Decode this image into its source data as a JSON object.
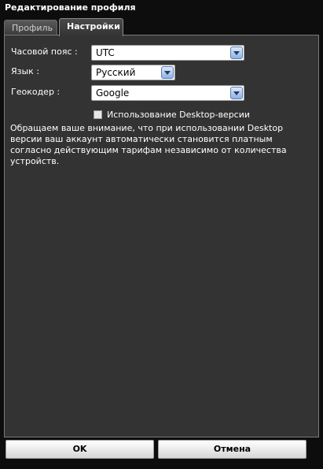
{
  "window": {
    "title": "Редактирование профиля"
  },
  "tabs": [
    {
      "label": "Профиль",
      "active": false
    },
    {
      "label": "Настройки",
      "active": true
    }
  ],
  "settings": {
    "timezone": {
      "label": "Часовой пояс :",
      "value": "UTC"
    },
    "language": {
      "label": "Язык :",
      "value": "Русский"
    },
    "geocoder": {
      "label": "Геокодер :",
      "value": "Google"
    },
    "desktop_checkbox": {
      "label": "Использование Desktop-версии",
      "checked": false
    },
    "notice": "Обращаем ваше внимание, что при использовании Desktop версии ваш аккаунт автоматически становится платным согласно действующим тарифам независимо от количества устройств."
  },
  "footer": {
    "ok_label": "OK",
    "cancel_label": "Отмена"
  },
  "colors": {
    "panel": "#333333",
    "background": "#0d0d0d",
    "dropdown_button": "#8fb1e2"
  }
}
